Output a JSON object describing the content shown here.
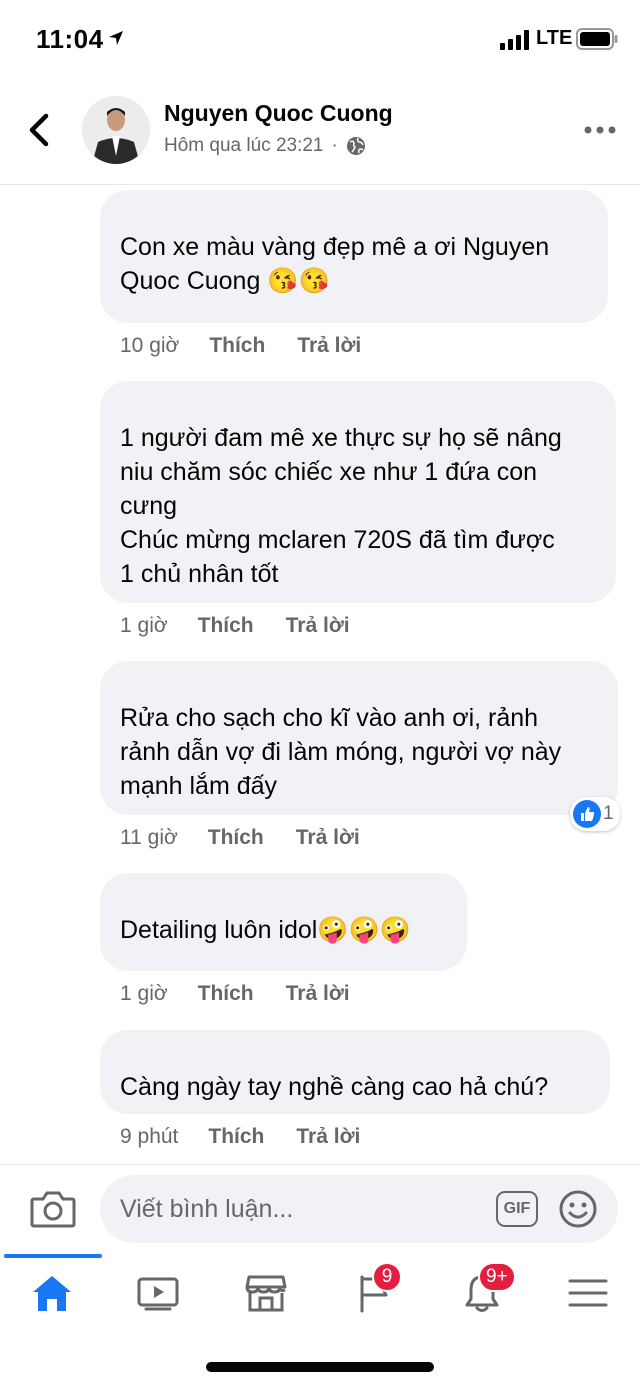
{
  "status_bar": {
    "time": "11:04",
    "network": "LTE"
  },
  "header": {
    "author": "Nguyen Quoc Cuong",
    "timestamp": "Hôm qua lúc 23:21",
    "separator": "·",
    "icons": {
      "back": "chevron-left-icon",
      "privacy": "globe-icon",
      "more": "more-horizontal-icon"
    }
  },
  "comments": [
    {
      "text": "Con xe màu vàng đẹp mê a ơi Nguyen\nQuoc Cuong 😘😘",
      "time": "10 giờ",
      "like": "Thích",
      "reply": "Trả lời"
    },
    {
      "text": "1 người đam mê xe thực sự họ sẽ nâng\nniu chăm sóc chiếc xe như 1 đứa con\ncưng\nChúc mừng mclaren 720S đã tìm được\n1 chủ nhân tốt",
      "time": "1 giờ",
      "like": "Thích",
      "reply": "Trả lời"
    },
    {
      "text": "Rửa cho sạch cho kĩ vào anh ơi, rảnh\nrảnh dẫn vợ đi làm móng, người vợ này\nmạnh lắm đấy",
      "time": "11 giờ",
      "like": "Thích",
      "reply": "Trả lời",
      "reaction_count": "1"
    },
    {
      "text": "Detailing luôn idol🤪🤪🤪",
      "time": "1 giờ",
      "like": "Thích",
      "reply": "Trả lời"
    },
    {
      "text": "Càng ngày tay nghề càng cao hả chú?",
      "time": "9 phút",
      "like": "Thích",
      "reply": "Trả lời"
    }
  ],
  "composer": {
    "placeholder": "Viết bình luận...",
    "gif_label": "GIF"
  },
  "tab_bar": {
    "tabs": [
      {
        "name": "home",
        "icon": "home-icon",
        "active": true
      },
      {
        "name": "watch",
        "icon": "video-icon"
      },
      {
        "name": "marketplace",
        "icon": "shop-icon"
      },
      {
        "name": "pages",
        "icon": "flag-icon",
        "badge": "9"
      },
      {
        "name": "notifications",
        "icon": "bell-icon",
        "badge": "9+"
      },
      {
        "name": "menu",
        "icon": "hamburger-icon"
      }
    ]
  },
  "colors": {
    "accent": "#1877f2",
    "bubble": "#f0f2f5",
    "secondary_text": "#65676b",
    "badge": "#e41e3f"
  }
}
